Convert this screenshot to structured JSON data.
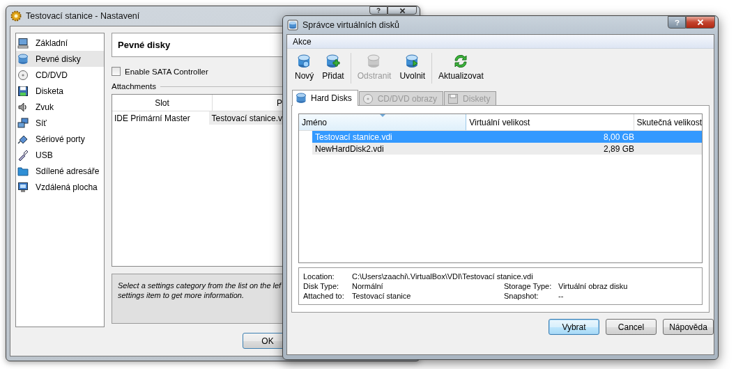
{
  "settings_window": {
    "title": "Testovací stanice - Nastavení",
    "sidebar": {
      "items": [
        {
          "label": "Základní",
          "selected": false
        },
        {
          "label": "Pevné disky",
          "selected": true
        },
        {
          "label": "CD/DVD",
          "selected": false
        },
        {
          "label": "Disketa",
          "selected": false
        },
        {
          "label": "Zvuk",
          "selected": false
        },
        {
          "label": "Síť",
          "selected": false
        },
        {
          "label": "Sériové porty",
          "selected": false
        },
        {
          "label": "USB",
          "selected": false
        },
        {
          "label": "Sdílené adresáře",
          "selected": false
        },
        {
          "label": "Vzdálená plocha",
          "selected": false
        }
      ]
    },
    "section_title": "Pevné disky",
    "sata_checkbox": {
      "label": "Enable SATA Controller",
      "checked": false
    },
    "attachments_label": "Attachments",
    "table": {
      "columns": [
        "Slot",
        "P"
      ],
      "rows": [
        [
          "IDE Primární Master",
          "Testovací stanice.v"
        ]
      ]
    },
    "info_lines": [
      "Select a settings category from the list on the lef",
      "settings item to get more information."
    ],
    "buttons": [
      "OK"
    ]
  },
  "disk_manager": {
    "title": "Správce virtuálních disků",
    "menu": [
      "Akce"
    ],
    "toolbar": [
      [
        {
          "label": "Nový",
          "disabled": false
        },
        {
          "label": "Přidat",
          "disabled": false
        }
      ],
      [
        {
          "label": "Odstranit",
          "disabled": true
        },
        {
          "label": "Uvolnit",
          "disabled": false
        }
      ],
      [
        {
          "label": "Aktualizovat",
          "disabled": false
        }
      ]
    ],
    "tabs": [
      {
        "label": "Hard Disks",
        "selected": true,
        "disabled": false
      },
      {
        "label": "CD/DVD obrazy",
        "selected": false,
        "disabled": true
      },
      {
        "label": "Diskety",
        "selected": false,
        "disabled": true
      }
    ],
    "table": {
      "columns": [
        {
          "label": "Jméno",
          "sorted": true
        },
        {
          "label": "Virtuální velikost",
          "sorted": false
        },
        {
          "label": "Skutečná velikost",
          "sorted": false
        }
      ],
      "rows": [
        {
          "name": "Testovací stanice.vdi",
          "virtual_size": "8,00 GB",
          "selected": true
        },
        {
          "name": "NewHardDisk2.vdi",
          "virtual_size": "2,89 GB",
          "selected": false
        }
      ]
    },
    "details": {
      "rows": [
        [
          {
            "label": "Location:",
            "value": "C:\\Users\\zaachi\\.VirtualBox\\VDI\\Testovací stanice.vdi"
          }
        ],
        [
          {
            "label": "Disk Type:",
            "value": "Normální"
          },
          {
            "label": "Storage Type:",
            "value": "Virtuální obraz disku"
          }
        ],
        [
          {
            "label": "Attached to:",
            "value": "Testovací stanice"
          },
          {
            "label": "Snapshot:",
            "value": "--"
          }
        ]
      ]
    },
    "buttons": [
      {
        "label": "Vybrat",
        "default": true
      },
      {
        "label": "Cancel",
        "default": false
      },
      {
        "label": "Nápověda",
        "default": false
      }
    ]
  }
}
